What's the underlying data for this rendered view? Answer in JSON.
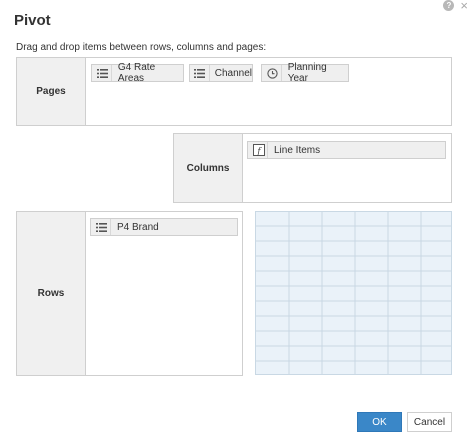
{
  "dialog": {
    "title": "Pivot",
    "instructions": "Drag and drop items between rows, columns and pages:"
  },
  "window_controls": {
    "help_icon": "help-icon",
    "close_icon": "close-icon",
    "help_glyph": "?",
    "close_glyph": "×"
  },
  "pages": {
    "label": "Pages",
    "items": [
      {
        "label": "G4 Rate Areas",
        "icon": "list-icon"
      },
      {
        "label": "Channel",
        "icon": "list-icon"
      },
      {
        "label": "Planning Year",
        "icon": "clock-icon"
      }
    ]
  },
  "columns": {
    "label": "Columns",
    "items": [
      {
        "label": "Line Items",
        "icon": "formula-icon"
      }
    ]
  },
  "rows": {
    "label": "Rows",
    "items": [
      {
        "label": "P4 Brand",
        "icon": "list-icon"
      }
    ]
  },
  "buttons": {
    "ok": "OK",
    "cancel": "Cancel"
  },
  "colors": {
    "accent": "#3a87c8",
    "zone_label_bg": "#f0f0f0",
    "grid_bg": "#eaf2f9",
    "grid_line": "#c9d8e4"
  }
}
